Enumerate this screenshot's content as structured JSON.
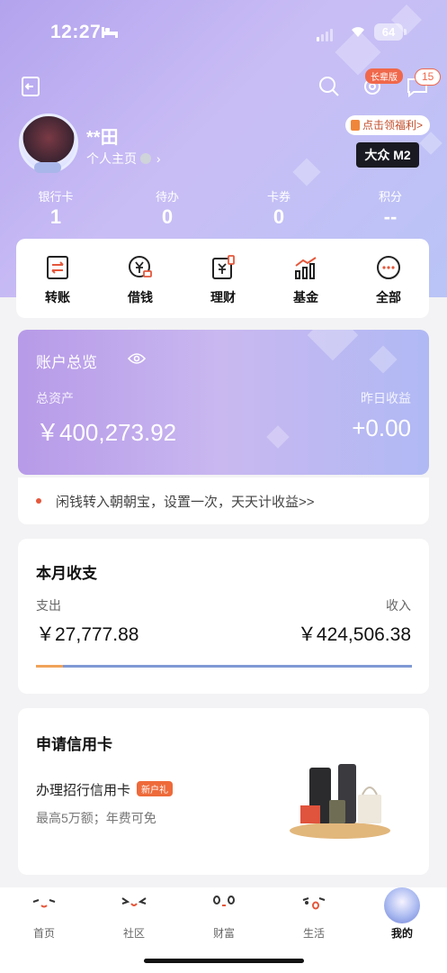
{
  "status_bar": {
    "time": "12:27",
    "battery": "64"
  },
  "header": {
    "elder_badge": "长辈版",
    "message_count": "15"
  },
  "profile": {
    "name": "**田",
    "home_link": "个人主页",
    "welfare": "点击领福利>",
    "level_badge": "大众 M2"
  },
  "stats": [
    {
      "label": "银行卡",
      "value": "1"
    },
    {
      "label": "待办",
      "value": "0"
    },
    {
      "label": "卡券",
      "value": "0"
    },
    {
      "label": "积分",
      "value": "--"
    }
  ],
  "quick_actions": [
    {
      "label": "转账",
      "icon": "transfer-icon"
    },
    {
      "label": "借钱",
      "icon": "borrow-icon"
    },
    {
      "label": "理财",
      "icon": "wealth-icon"
    },
    {
      "label": "基金",
      "icon": "fund-icon"
    },
    {
      "label": "全部",
      "icon": "more-icon"
    }
  ],
  "account": {
    "title": "账户总览",
    "total_label": "总资产",
    "total_value": "￥400,273.92",
    "yesterday_label": "昨日收益",
    "yesterday_value": "+0.00"
  },
  "promo": {
    "text": "闲钱转入朝朝宝，设置一次，天天计收益>>"
  },
  "monthly": {
    "title": "本月收支",
    "expense_label": "支出",
    "expense_value": "￥27,777.88",
    "income_label": "收入",
    "income_value": "￥424,506.38"
  },
  "credit_card": {
    "title": "申请信用卡",
    "name": "办理招行信用卡",
    "tag": "新户礼",
    "subtitle": "最高5万额；年费可免"
  },
  "tabbar": [
    {
      "label": "首页"
    },
    {
      "label": "社区"
    },
    {
      "label": "财富"
    },
    {
      "label": "生活"
    },
    {
      "label": "我的"
    }
  ],
  "colors": {
    "accent_purple": "#b79ae8",
    "badge_red": "#f0684b",
    "expense_orange": "#f0a35a",
    "income_blue": "#7f99d4"
  }
}
